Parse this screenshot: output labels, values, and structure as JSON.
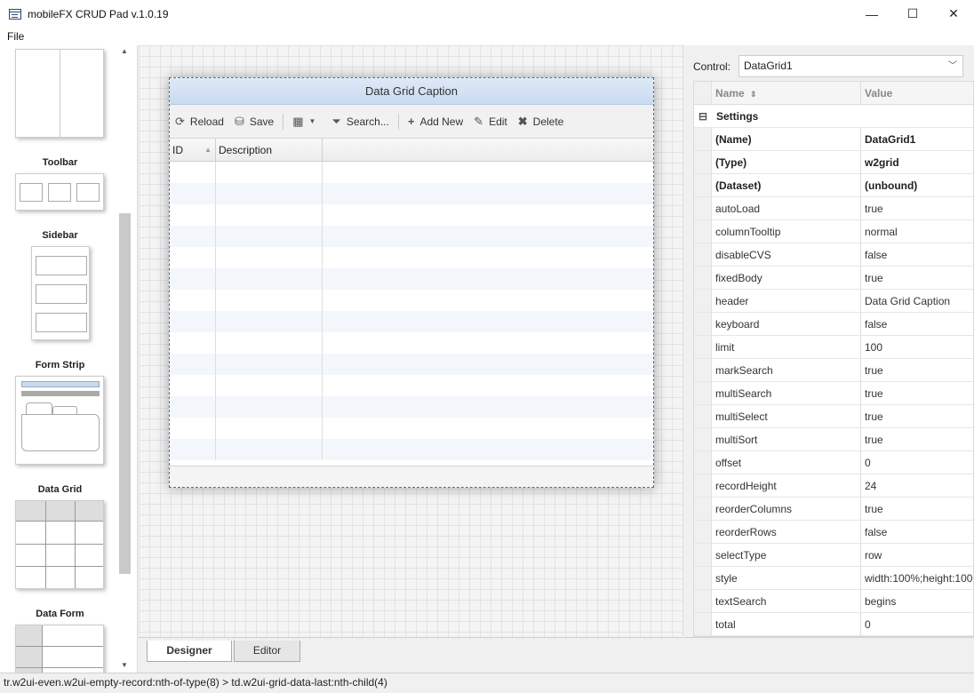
{
  "window": {
    "title": "mobileFX CRUD Pad v.1.0.19",
    "minimize": "—",
    "maximize": "☐",
    "close": "✕"
  },
  "menu": {
    "file": "File"
  },
  "toolbox": {
    "items": [
      {
        "label": "Toolbar"
      },
      {
        "label": "Sidebar"
      },
      {
        "label": "Form Strip"
      },
      {
        "label": "Data Grid"
      },
      {
        "label": "Data Form"
      }
    ]
  },
  "designer": {
    "grid": {
      "caption": "Data Grid Caption",
      "toolbar": {
        "reload": "Reload",
        "save": "Save",
        "search": "Search...",
        "add_new": "Add New",
        "edit": "Edit",
        "delete": "Delete"
      },
      "columns": [
        "ID",
        "Description"
      ]
    }
  },
  "tabs": {
    "designer": "Designer",
    "editor": "Editor"
  },
  "properties": {
    "control_label": "Control:",
    "control_value": "DataGrid1",
    "header_name": "Name",
    "header_value": "Value",
    "section": "Settings",
    "rows": [
      {
        "name": "(Name)",
        "value": "DataGrid1"
      },
      {
        "name": "(Type)",
        "value": "w2grid"
      },
      {
        "name": "(Dataset)",
        "value": "(unbound)"
      },
      {
        "name": "autoLoad",
        "value": "true"
      },
      {
        "name": "columnTooltip",
        "value": "normal"
      },
      {
        "name": "disableCVS",
        "value": "false"
      },
      {
        "name": "fixedBody",
        "value": "true"
      },
      {
        "name": "header",
        "value": "Data Grid Caption"
      },
      {
        "name": "keyboard",
        "value": "false"
      },
      {
        "name": "limit",
        "value": "100"
      },
      {
        "name": "markSearch",
        "value": "true"
      },
      {
        "name": "multiSearch",
        "value": "true"
      },
      {
        "name": "multiSelect",
        "value": "true"
      },
      {
        "name": "multiSort",
        "value": "true"
      },
      {
        "name": "offset",
        "value": "0"
      },
      {
        "name": "recordHeight",
        "value": "24"
      },
      {
        "name": "reorderColumns",
        "value": "true"
      },
      {
        "name": "reorderRows",
        "value": "false"
      },
      {
        "name": "selectType",
        "value": "row"
      },
      {
        "name": "style",
        "value": "width:100%;height:100"
      },
      {
        "name": "textSearch",
        "value": "begins"
      },
      {
        "name": "total",
        "value": "0"
      }
    ]
  },
  "status": {
    "text": "tr.w2ui-even.w2ui-empty-record:nth-of-type(8) > td.w2ui-grid-data-last:nth-child(4)"
  }
}
